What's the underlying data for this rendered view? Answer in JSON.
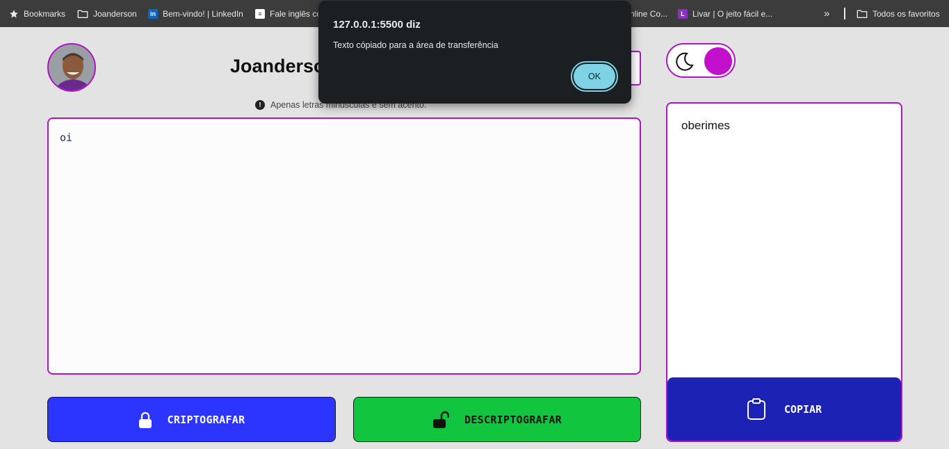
{
  "bookmarks_bar": {
    "items": [
      {
        "label": "Bookmarks",
        "icon": "star-icon"
      },
      {
        "label": "Joanderson",
        "icon": "folder-icon"
      },
      {
        "label": "Bem-vindo! | LinkedIn",
        "icon": "linkedin-icon"
      },
      {
        "label": "Fale inglês co",
        "icon": "page-icon"
      },
      {
        "label": "nline Co...",
        "icon": ""
      },
      {
        "label": "Livar | O jeito fácil e...",
        "icon": "livar-icon"
      }
    ],
    "overflow_label": "»",
    "all_bookmarks_label": "Todos os favoritos"
  },
  "header": {
    "title": "Joanderso",
    "hint": "Apenas letras minúsculas e sem acento."
  },
  "input": {
    "value": "oi"
  },
  "buttons": {
    "encrypt_label": "CRIPTOGRAFAR",
    "decrypt_label": "DESCRIPTOGRAFAR",
    "copy_label": "COPIAR"
  },
  "output": {
    "text": "oberimes"
  },
  "theme_toggle": {
    "state": "on"
  },
  "dialog": {
    "title": "127.0.0.1:5500 diz",
    "message": "Texto cópiado para a área de transferência",
    "ok_label": "OK"
  },
  "colors": {
    "accent_border": "#b012c8",
    "encrypt_button": "#2c35ff",
    "decrypt_button": "#11c63e",
    "copy_button": "#1c22b4",
    "toggle_knob": "#c10fcc",
    "dialog_ok": "#7ed2e3"
  }
}
